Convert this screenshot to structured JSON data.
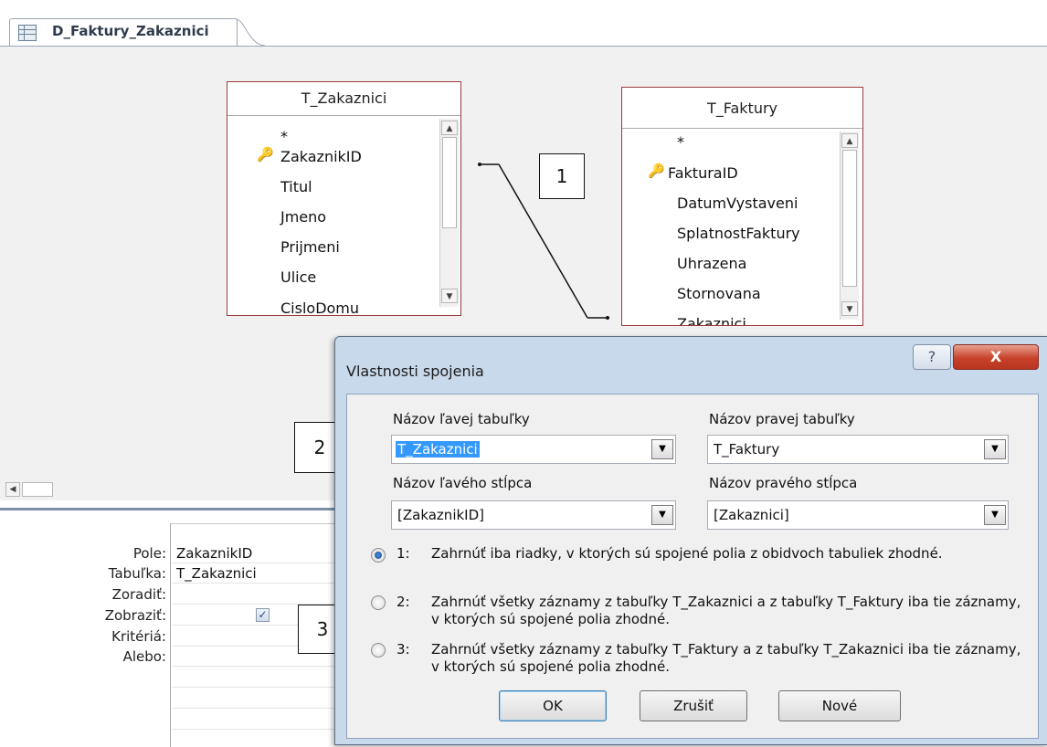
{
  "tab": {
    "title": "D_Faktury_Zakaznici"
  },
  "tables": [
    {
      "name": "T_Zakaznici",
      "fields": [
        "*",
        "ZakaznikID",
        "Titul",
        "Jmeno",
        "Prijmeni",
        "Ulice",
        "CisloDomu"
      ],
      "primary_key": "ZakaznikID"
    },
    {
      "name": "T_Faktury",
      "fields": [
        "*",
        "FakturaID",
        "DatumVystaveni",
        "SplatnostFaktury",
        "Uhrazena",
        "Stornovana",
        "Zakaznici"
      ],
      "primary_key": "FakturaID"
    }
  ],
  "callouts": [
    "1",
    "2",
    "3"
  ],
  "grid": {
    "row_labels": [
      "Pole:",
      "Tabuľka:",
      "Zoradiť:",
      "Zobraziť:",
      "Kritériá:",
      "Alebo:"
    ],
    "values": {
      "pole": "ZakaznikID",
      "tabulka": "T_Zakaznici",
      "zobrazit": true
    }
  },
  "dialog": {
    "title": "Vlastnosti spojenia",
    "help_label": "?",
    "close_label": "X",
    "left_table_label": "Názov ľavej tabuľky",
    "left_table_value": "T_Zakaznici",
    "right_table_label": "Názov pravej tabuľky",
    "right_table_value": "T_Faktury",
    "left_column_label": "Názov ľavého stĺpca",
    "left_column_value": "[ZakaznikID]",
    "right_column_label": "Názov pravého stĺpca",
    "right_column_value": "[Zakaznici]",
    "options": [
      {
        "num": "1:",
        "text": "Zahrnúť iba riadky, v ktorých sú spojené polia z obidvoch tabuliek zhodné.",
        "selected": true
      },
      {
        "num": "2:",
        "text": "Zahrnúť všetky záznamy z tabuľky T_Zakaznici a z tabuľky T_Faktury iba tie záznamy, v ktorých sú spojené polia zhodné.",
        "selected": false
      },
      {
        "num": "3:",
        "text": "Zahrnúť všetky záznamy z tabuľky T_Faktury a z tabuľky T_Zakaznici iba tie záznamy, v ktorých sú spojené polia zhodné.",
        "selected": false
      }
    ],
    "buttons": {
      "ok": "OK",
      "cancel": "Zrušiť",
      "new": "Nové"
    }
  },
  "icons": [
    "table-icon",
    "key-icon",
    "scroll-up-icon",
    "scroll-down-icon",
    "scroll-left-icon",
    "dropdown-arrow-icon",
    "checkbox-check-icon",
    "help-icon",
    "close-icon"
  ]
}
